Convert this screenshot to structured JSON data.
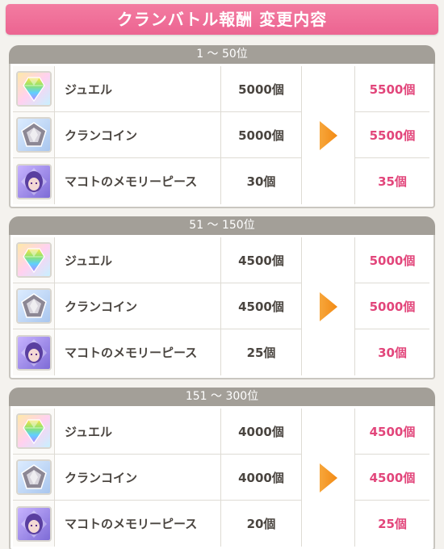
{
  "title": "クランバトル報酬 変更内容",
  "colors": {
    "title_bg": "#ef6f99",
    "header_bg": "#a39f98",
    "after_text": "#e2467b",
    "arrow": "#f28a14"
  },
  "sections": [
    {
      "header": "1 ～ 50位",
      "rows": [
        {
          "icon": "jewel-icon",
          "name": "ジュエル",
          "before": "5000個",
          "after": "5500個"
        },
        {
          "icon": "clan-coin-icon",
          "name": "クランコイン",
          "before": "5000個",
          "after": "5500個"
        },
        {
          "icon": "makoto-memory-piece-icon",
          "name": "マコトのメモリーピース",
          "before": "30個",
          "after": "35個"
        }
      ]
    },
    {
      "header": "51 ～ 150位",
      "rows": [
        {
          "icon": "jewel-icon",
          "name": "ジュエル",
          "before": "4500個",
          "after": "5000個"
        },
        {
          "icon": "clan-coin-icon",
          "name": "クランコイン",
          "before": "4500個",
          "after": "5000個"
        },
        {
          "icon": "makoto-memory-piece-icon",
          "name": "マコトのメモリーピース",
          "before": "25個",
          "after": "30個"
        }
      ]
    },
    {
      "header": "151 ～ 300位",
      "rows": [
        {
          "icon": "jewel-icon",
          "name": "ジュエル",
          "before": "4000個",
          "after": "4500個"
        },
        {
          "icon": "clan-coin-icon",
          "name": "クランコイン",
          "before": "4000個",
          "after": "4500個"
        },
        {
          "icon": "makoto-memory-piece-icon",
          "name": "マコトのメモリーピース",
          "before": "20個",
          "after": "25個"
        }
      ]
    }
  ]
}
